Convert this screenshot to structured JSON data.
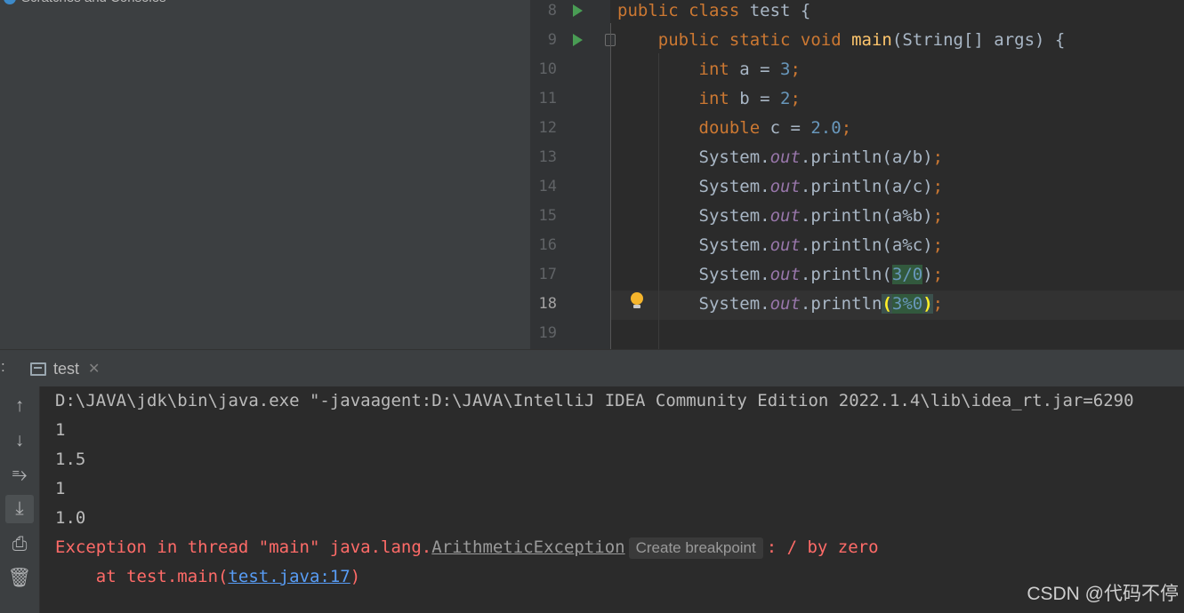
{
  "project": {
    "scratches_label": "Scratches and Consoles"
  },
  "editor": {
    "active_line": "18",
    "lines": [
      {
        "num": "8",
        "tokens": [
          [
            "kw",
            "public "
          ],
          [
            "kw",
            "class "
          ],
          [
            "plain",
            "test {"
          ]
        ]
      },
      {
        "num": "9",
        "tokens": [
          [
            "plain",
            "    "
          ],
          [
            "kw",
            "public static void "
          ],
          [
            "fn",
            "main"
          ],
          [
            "plain",
            "(String[] args) {"
          ]
        ]
      },
      {
        "num": "10",
        "tokens": [
          [
            "plain",
            "        "
          ],
          [
            "kw",
            "int "
          ],
          [
            "plain",
            "a = "
          ],
          [
            "num",
            "3"
          ],
          [
            "kw",
            ";"
          ]
        ]
      },
      {
        "num": "11",
        "tokens": [
          [
            "plain",
            "        "
          ],
          [
            "kw",
            "int "
          ],
          [
            "plain",
            "b = "
          ],
          [
            "num",
            "2"
          ],
          [
            "kw",
            ";"
          ]
        ]
      },
      {
        "num": "12",
        "tokens": [
          [
            "plain",
            "        "
          ],
          [
            "kw",
            "double "
          ],
          [
            "plain",
            "c = "
          ],
          [
            "num",
            "2.0"
          ],
          [
            "kw",
            ";"
          ]
        ]
      },
      {
        "num": "13",
        "tokens": [
          [
            "plain",
            "        System."
          ],
          [
            "out",
            "out"
          ],
          [
            "plain",
            ".println(a/b)"
          ],
          [
            "kw",
            ";"
          ]
        ]
      },
      {
        "num": "14",
        "tokens": [
          [
            "plain",
            "        System."
          ],
          [
            "out",
            "out"
          ],
          [
            "plain",
            ".println(a/c)"
          ],
          [
            "kw",
            ";"
          ]
        ]
      },
      {
        "num": "15",
        "tokens": [
          [
            "plain",
            "        System."
          ],
          [
            "out",
            "out"
          ],
          [
            "plain",
            ".println(a%b)"
          ],
          [
            "kw",
            ";"
          ]
        ]
      },
      {
        "num": "16",
        "tokens": [
          [
            "plain",
            "        System."
          ],
          [
            "out",
            "out"
          ],
          [
            "plain",
            ".println(a%c)"
          ],
          [
            "kw",
            ";"
          ]
        ]
      },
      {
        "num": "17",
        "tokens": [
          [
            "plain",
            "        System."
          ],
          [
            "out",
            "out"
          ],
          [
            "plain",
            ".println("
          ],
          [
            "warn-num",
            "3/0"
          ],
          [
            "plain",
            ")"
          ],
          [
            "kw",
            ";"
          ]
        ]
      },
      {
        "num": "18",
        "tokens": [
          [
            "plain",
            "        System."
          ],
          [
            "out",
            "out"
          ],
          [
            "plain",
            ".println"
          ],
          [
            "brace",
            "("
          ],
          [
            "warn-num",
            "3%0"
          ],
          [
            "brace",
            ")"
          ],
          [
            "kw",
            ";"
          ]
        ]
      },
      {
        "num": "19",
        "tokens": []
      }
    ]
  },
  "tool_window": {
    "tab_label": "test",
    "colon": ":"
  },
  "console": {
    "command": "D:\\JAVA\\jdk\\bin\\java.exe \"-javaagent:D:\\JAVA\\IntelliJ IDEA Community Edition 2022.1.4\\lib\\idea_rt.jar=6290",
    "outputs": [
      "1",
      "1.5",
      "1",
      "1.0"
    ],
    "exception_prefix": "Exception in thread \"main\" java.lang.",
    "exception_class": "ArithmeticException",
    "breakpoint_chip": "Create breakpoint",
    "exception_suffix": ": / by zero",
    "stack_prefix": "    at test.main(",
    "stack_link": "test.java:17",
    "stack_suffix": ")"
  },
  "toolbar_icons": [
    "arrow-up-icon",
    "arrow-down-icon",
    "soft-wrap-icon",
    "scroll-to-end-icon",
    "print-icon",
    "trash-icon"
  ],
  "watermark": "CSDN @代码不停",
  "colors": {
    "keyword": "#cc7832",
    "number": "#6897bb",
    "error": "#ff6b68",
    "link": "#589df6"
  }
}
